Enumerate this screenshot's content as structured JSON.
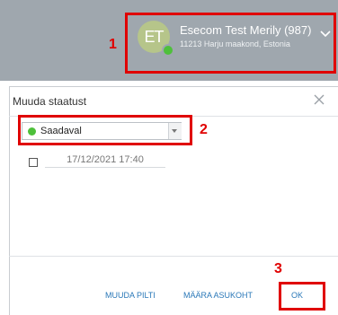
{
  "header": {
    "avatar_initials": "ET",
    "user_name": "Esecom Test Merily (987)",
    "user_location": "11213 Harju maakond, Estonia"
  },
  "dialog": {
    "title": "Muuda staatust",
    "status_value": "Saadaval",
    "status_color": "#4ec03b",
    "date_value": "17/12/2021 17:40",
    "buttons": {
      "change_picture": "MUUDA PILTI",
      "set_location": "MÄÄRA ASUKOHT",
      "ok": "OK"
    }
  },
  "annotations": {
    "n1": "1",
    "n2": "2",
    "n3": "3",
    "color": "#e00000"
  }
}
